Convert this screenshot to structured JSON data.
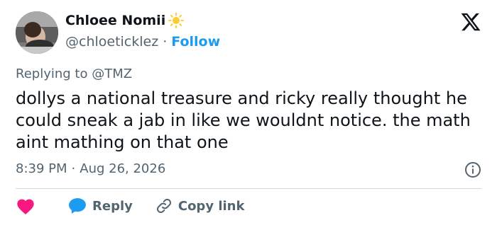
{
  "author": {
    "display_name": "Chloee Nomii",
    "handle": "@chloeticklez",
    "separator": "·",
    "follow_label": "Follow",
    "emoji_icon": "sun-icon"
  },
  "reply_context": {
    "prefix": "Replying to",
    "mention": "@TMZ"
  },
  "tweet": {
    "text": "dollys a national treasure and ricky really thought he could sneak a jab in like we wouldnt notice. the math aint mathing on that one",
    "time": "8:39 PM",
    "separator": "·",
    "date": "Aug 26, 2026"
  },
  "actions": {
    "like_icon": "heart-icon",
    "reply_label": "Reply",
    "copy_label": "Copy link"
  },
  "colors": {
    "accent": "#1d9bf0",
    "heart": "#f91880",
    "secondary_text": "#536471",
    "primary_text": "#0f1419",
    "divider": "#cfd9de"
  }
}
